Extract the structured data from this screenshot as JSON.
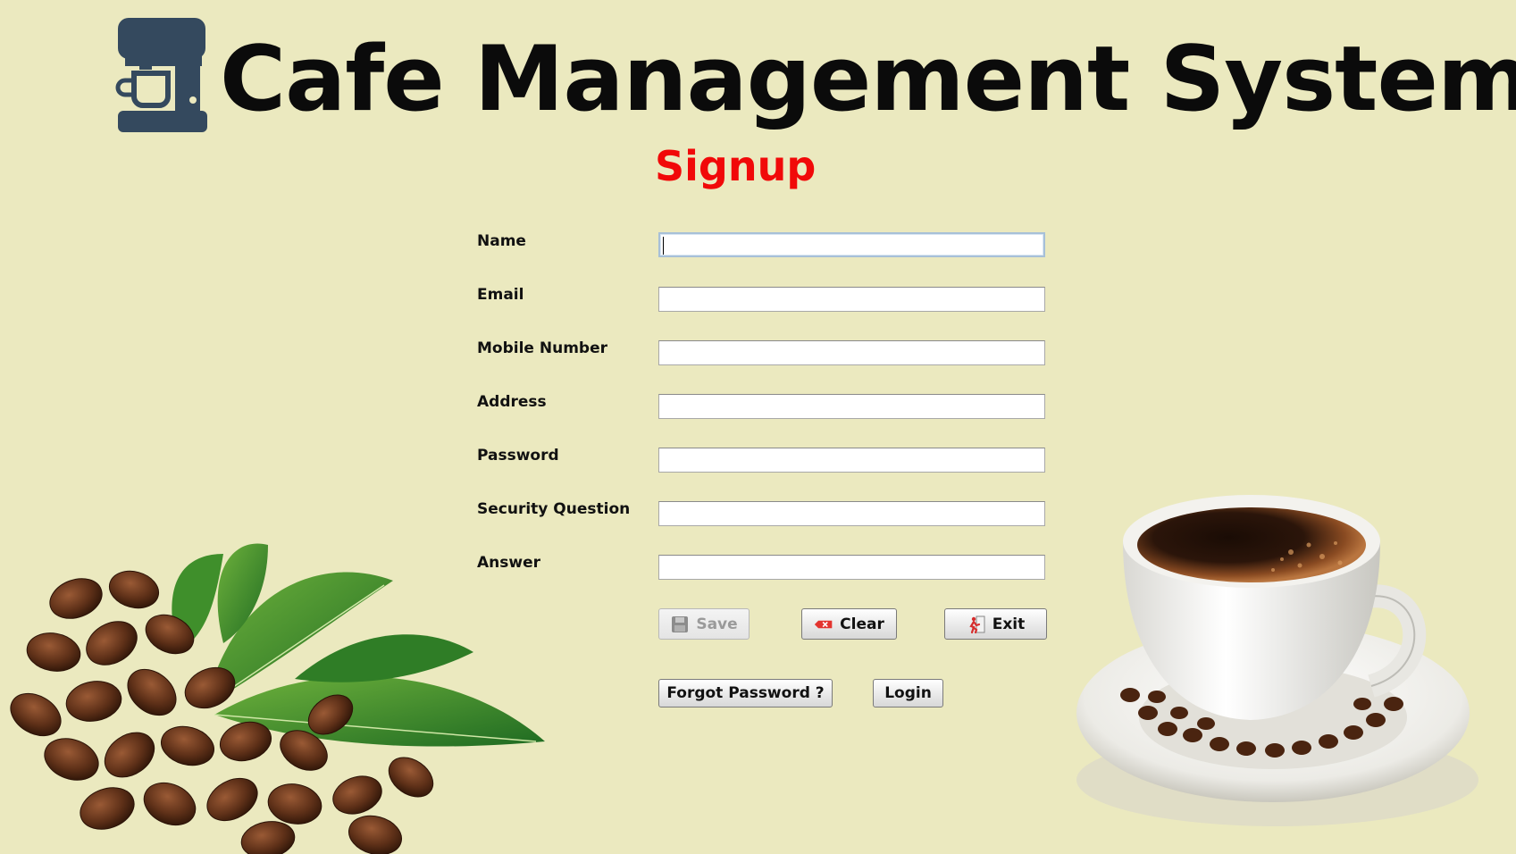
{
  "app": {
    "title": "Cafe Management System",
    "logo_icon": "coffee-machine-icon"
  },
  "form": {
    "title": "Signup",
    "fields": [
      {
        "label": "Name",
        "value": "",
        "placeholder": ""
      },
      {
        "label": "Email",
        "value": "",
        "placeholder": ""
      },
      {
        "label": "Mobile Number",
        "value": "",
        "placeholder": ""
      },
      {
        "label": "Address",
        "value": "",
        "placeholder": ""
      },
      {
        "label": "Password",
        "value": "",
        "placeholder": ""
      },
      {
        "label": "Security Question",
        "value": "",
        "placeholder": ""
      },
      {
        "label": "Answer",
        "value": "",
        "placeholder": ""
      }
    ],
    "focused_field": "Name"
  },
  "buttons": {
    "save": {
      "label": "Save",
      "icon": "floppy-disk-icon",
      "enabled": false
    },
    "clear": {
      "label": "Clear",
      "icon": "eraser-icon",
      "enabled": true
    },
    "exit": {
      "label": "Exit",
      "icon": "exit-door-icon",
      "enabled": true
    },
    "forgot_password": {
      "label": "Forgot Password ?",
      "enabled": true
    },
    "login": {
      "label": "Login",
      "enabled": true
    }
  },
  "decorations": {
    "left_image": "coffee-beans-leaves-image",
    "right_image": "coffee-cup-image"
  },
  "colors": {
    "background": "#ebe9bf",
    "title": "#0b0b0b",
    "form_title": "#f10909",
    "logo": "#34495e"
  }
}
